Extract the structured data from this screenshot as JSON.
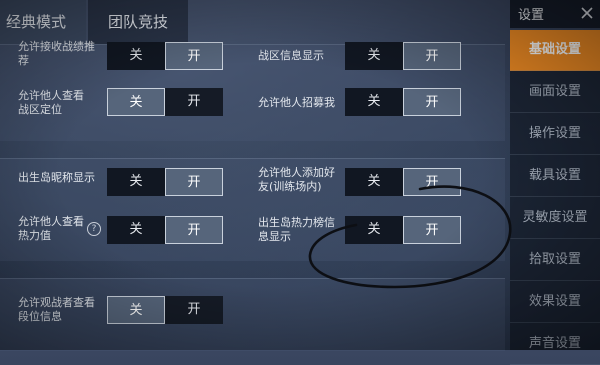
{
  "tabs": [
    {
      "label": "经典模式"
    },
    {
      "label": "团队竞技"
    }
  ],
  "header": {
    "title": "设置"
  },
  "sidebar": {
    "items": [
      {
        "label": "基础设置"
      },
      {
        "label": "画面设置"
      },
      {
        "label": "操作设置"
      },
      {
        "label": "载具设置"
      },
      {
        "label": "灵敏度设置"
      },
      {
        "label": "拾取设置"
      },
      {
        "label": "效果设置"
      },
      {
        "label": "声音设置"
      }
    ]
  },
  "settings": {
    "accept_match_invite": {
      "label": "允许接收战绩推荐",
      "off": "关",
      "on": "开",
      "value": "开"
    },
    "zone_info": {
      "label": "战区信息显示",
      "off": "关",
      "on": "开",
      "value": "开"
    },
    "view_zone": {
      "label": "允许他人查看战区定位",
      "off": "关",
      "on": "开",
      "value": "关"
    },
    "recruit": {
      "label": "允许他人招募我",
      "off": "关",
      "on": "开",
      "value": "开"
    },
    "nickname": {
      "label": "出生岛昵称显示",
      "off": "关",
      "on": "开",
      "value": "开"
    },
    "add_friend": {
      "label": "允许他人添加好友(训练场内)",
      "off": "关",
      "on": "开",
      "value": "开"
    },
    "heat_value": {
      "label": "允许他人查看热力值",
      "off": "关",
      "on": "开",
      "value": "开"
    },
    "heat_list": {
      "label": "出生岛热力榜信息显示",
      "off": "关",
      "on": "开",
      "value": "开"
    },
    "spectator_rank": {
      "label": "允许观战者查看段位信息",
      "off": "关",
      "on": "开",
      "value": "关"
    }
  },
  "colors": {
    "accent": "#f08c24",
    "toggle_selected": "#56657b",
    "toggle_dark": "#111722"
  },
  "icons": {
    "close": "close-icon",
    "help": "question-circle-icon"
  }
}
